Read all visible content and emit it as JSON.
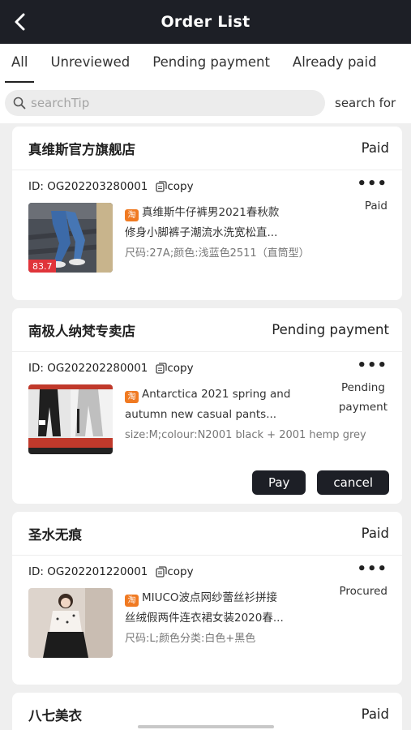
{
  "header": {
    "title": "Order List"
  },
  "tabs": [
    {
      "label": "All"
    },
    {
      "label": "Unreviewed"
    },
    {
      "label": "Pending payment"
    },
    {
      "label": "Already paid"
    }
  ],
  "search": {
    "placeholder": "searchTip",
    "button_label": "search for"
  },
  "copy_label": "copy",
  "orders": [
    {
      "shop": "真维斯官方旗舰店",
      "status": "Paid",
      "id_label": "ID: OG202203280001",
      "title": "真维斯牛仔裤男2021春秋款",
      "title2": "修身小脚裤子潮流水洗宽松直...",
      "spec": "尺码:27A;颜色:浅蓝色2511（直筒型）",
      "item_status": "Paid",
      "price_tag": "83.7"
    },
    {
      "shop": "南极人纳梵专卖店",
      "status": "Pending payment",
      "id_label": "ID: OG202202280001",
      "title": "Antarctica 2021 spring and",
      "title2": "autumn new casual pants...",
      "spec": "size:M;colour:N2001 black + 2001 hemp grey",
      "item_status": "Pending payment",
      "item_status_line1": "Pending",
      "item_status_line2": "payment",
      "actions": {
        "pay": "Pay",
        "cancel": "cancel"
      }
    },
    {
      "shop": "圣水无痕",
      "status": "Paid",
      "id_label": "ID: OG202201220001",
      "title": "MIUCO波点网纱蕾丝衫拼接",
      "title2": "丝绒假两件连衣裙女装2020春...",
      "spec": "尺码:L;颜色分类:白色+黑色",
      "item_status": "Procured"
    },
    {
      "shop": "八七美衣",
      "status": "Paid"
    }
  ],
  "colors": {
    "header_bg": "#1d1f26",
    "taobao_tag": "#f07a22",
    "page_bg": "#efefef"
  }
}
